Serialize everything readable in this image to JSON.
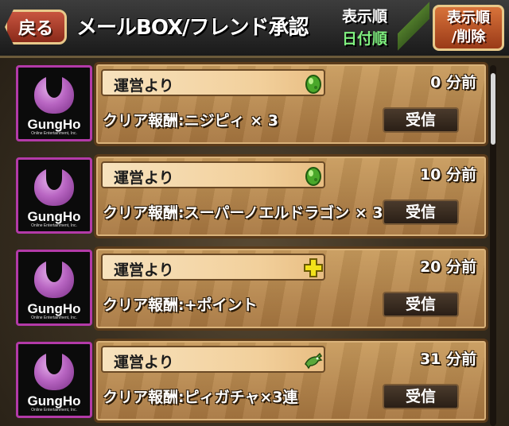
{
  "header": {
    "back_label": "戻る",
    "title": "メールBOX/フレンド承認",
    "sort_label": "表示順",
    "sort_value": "日付順",
    "display_button_line1": "表示順",
    "display_button_line2": "/削除"
  },
  "avatar": {
    "brand": "GungHo",
    "subtitle": "Online Entertainment, Inc."
  },
  "mails": [
    {
      "sender": "運営より",
      "reward": "クリア報酬:ニジピィ × 3",
      "time": "0 分前",
      "receive_label": "受信",
      "icon": "green-egg-icon"
    },
    {
      "sender": "運営より",
      "reward": "クリア報酬:スーパーノエルドラゴン × 3",
      "time": "10 分前",
      "receive_label": "受信",
      "icon": "green-egg-icon"
    },
    {
      "sender": "運営より",
      "reward": "クリア報酬:+ポイント",
      "time": "20 分前",
      "receive_label": "受信",
      "icon": "plus-icon"
    },
    {
      "sender": "運営より",
      "reward": "クリア報酬:ピィガチャ×3連",
      "time": "31 分前",
      "receive_label": "受信",
      "icon": "dragon-icon"
    }
  ],
  "colors": {
    "sort_value": "#7ff07f",
    "avatar_border": "#b33aa8",
    "plus_icon": "#f2e21a",
    "egg_icon": "#4aa82a"
  }
}
